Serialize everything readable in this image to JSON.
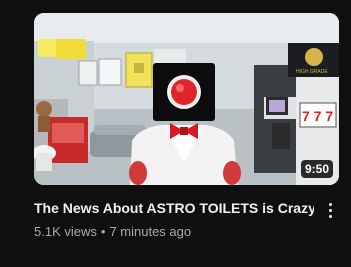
{
  "video": {
    "title": "The News About ASTRO TOILETS is Crazy",
    "views": "5.1K views",
    "separator": "•",
    "age": "7 minutes ago",
    "duration": "9:50"
  },
  "thumbnail": {
    "sign_text": "HIGH GRADE",
    "slot_text": "7 7 7",
    "colors": {
      "head": "#0c0c0c",
      "lens": "#e0262a",
      "bowtie": "#d8191f",
      "suit": "#f3f3f3",
      "banner_yellow": "#f2dc3a",
      "red_cabinet": "#c62a2a"
    }
  },
  "icons": {
    "more": "more-vert-icon"
  }
}
